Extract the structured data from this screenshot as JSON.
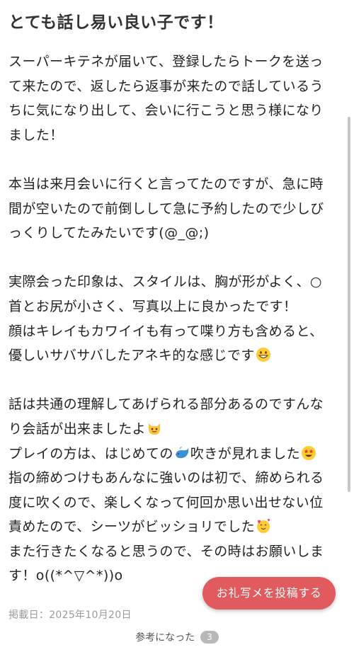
{
  "review": {
    "title": "とても話し易い良い子です！",
    "p1": {
      "l1": "スーパーキテネが届いて、登録したらトークを送っ",
      "l2": "て来たので、返したら返事が来たので話しているう",
      "l3": "ちに気になり出して、会いに行こうと思う様になり",
      "l4": "ました！"
    },
    "p2": {
      "l1": "本当は来月会いに行くと言ってたのですが、急に時",
      "l2": "間が空いたので前倒しして急に予約したので少しび",
      "l3": "っくりしてたみたいです(@_@;)"
    },
    "p3": {
      "l1": "実際会った印象は、スタイルは、胸が形がよく、○",
      "l2": "首とお尻が小さく、写真以上に良かったです！",
      "l3": "顔はキレイもカワイイも有って喋り方も含めると、",
      "l4": "優しいサバサバしたアネキ的な感じです"
    },
    "p4": {
      "l1": "話は共通の理解してあげられる部分あるのですんな",
      "l2": "り会話が出来ましたよ",
      "l3a": "プレイの方は、はじめての",
      "l3b": "吹きが見れました",
      "l4": "指の締めつけもあんなに強いのは初で、締められる",
      "l5": "度に吹くので、楽しくなって何回か思い出せない位",
      "l6": "責めたので、シーツがビッショリでした",
      "l7": "また行きたくなると思うので、その時はお願いしま",
      "l8": "す！o((*^▽^*))o"
    },
    "posted_date": "掲載日：2025年10月20日",
    "helpful_label": "参考になった",
    "helpful_count": "3"
  },
  "fab": {
    "label": "お礼写メを投稿する"
  },
  "icons": {
    "e1": "grinning-face-emoji",
    "e2": "cat-face-emoji",
    "e3": "whale-emoji",
    "e4": "star-struck-emoji",
    "e5": "smiling-face-with-hearts-emoji"
  },
  "colors": {
    "fab_background": "#e05a5e",
    "text": "#222222",
    "muted": "#9a9a9a",
    "badge": "#b8b8b8"
  }
}
